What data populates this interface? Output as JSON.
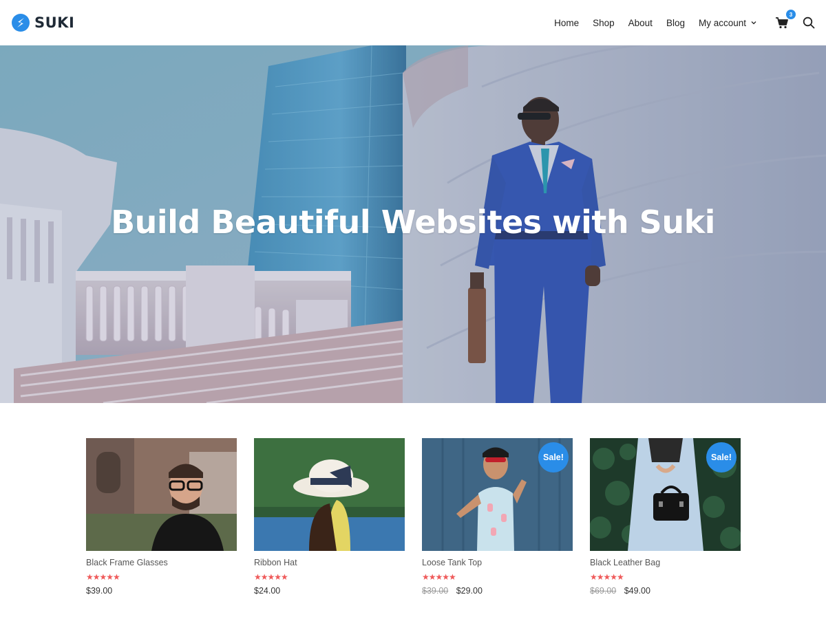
{
  "header": {
    "brand": "SUKI",
    "nav": [
      {
        "label": "Home"
      },
      {
        "label": "Shop"
      },
      {
        "label": "About"
      },
      {
        "label": "Blog"
      },
      {
        "label": "My account"
      }
    ],
    "cart_count": "3",
    "icons": {
      "logo": "suki-logo-icon",
      "cart": "cart-icon",
      "search": "search-icon",
      "dropdown": "chevron-down-icon"
    }
  },
  "hero": {
    "title": "Build Beautiful Websites with Suki"
  },
  "products": [
    {
      "name": "Black Frame Glasses",
      "rating": 5,
      "stars": "★★★★★",
      "old_price": "",
      "price": "$39.00",
      "sale": ""
    },
    {
      "name": "Ribbon Hat",
      "rating": 5,
      "stars": "★★★★★",
      "old_price": "",
      "price": "$24.00",
      "sale": ""
    },
    {
      "name": "Loose Tank Top",
      "rating": 5,
      "stars": "★★★★★",
      "old_price": "$39.00",
      "price": "$29.00",
      "sale": "Sale!"
    },
    {
      "name": "Black Leather Bag",
      "rating": 5,
      "stars": "★★★★★",
      "old_price": "$69.00",
      "price": "$49.00",
      "sale": "Sale!"
    }
  ],
  "colors": {
    "accent": "#2a8de8",
    "stars": "#ef5a5a"
  }
}
